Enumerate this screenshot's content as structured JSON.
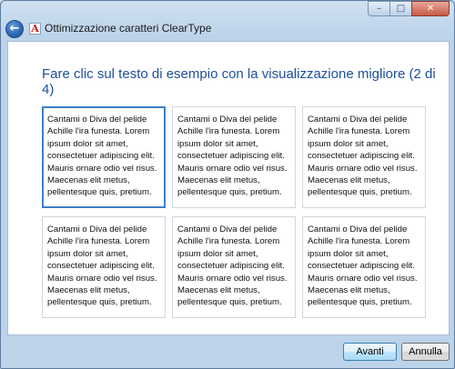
{
  "window": {
    "title": "Ottimizzazione caratteri ClearType",
    "app_icon_glyph": "A",
    "caption_min": "–",
    "caption_max": "□",
    "caption_close": "✕"
  },
  "back_button": {
    "glyph": "←",
    "icon": "back-arrow-icon"
  },
  "heading": "Fare clic sul testo di esempio con la visualizzazione migliore (2 di 4)",
  "samples": [
    {
      "text": "Cantami o Diva del pelide\nAchille l'ira funesta. Lorem\nipsum dolor sit amet,\nconsectetuer adipiscing elit.\nMauris ornare odio vel risus.\nMaecenas elit metus,\npellentesque quis, pretium.",
      "selected": true
    },
    {
      "text": "Cantami o Diva del pelide\nAchille l'ira funesta. Lorem\nipsum dolor sit amet,\nconsectetuer adipiscing elit.\nMauris ornare odio vel risus.\nMaecenas elit metus,\npellentesque quis, pretium.",
      "selected": false
    },
    {
      "text": "Cantami o Diva del pelide\nAchille l'ira funesta. Lorem\nipsum dolor sit amet,\nconsectetuer adipiscing elit.\nMauris ornare odio vel risus.\nMaecenas elit metus,\npellentesque quis, pretium.",
      "selected": false
    },
    {
      "text": "Cantami o Diva del pelide\nAchille l'ira funesta. Lorem\nipsum dolor sit amet,\nconsectetuer adipiscing elit.\nMauris ornare odio vel risus.\nMaecenas elit metus,\npellentesque quis, pretium.",
      "selected": false
    },
    {
      "text": "Cantami o Diva del pelide\nAchille l'ira funesta. Lorem\nipsum dolor sit amet,\nconsectetuer adipiscing elit.\nMauris ornare odio vel risus.\nMaecenas elit metus,\npellentesque quis, pretium.",
      "selected": false
    },
    {
      "text": "Cantami o Diva del pelide\nAchille l'ira funesta. Lorem\nipsum dolor sit amet,\nconsectetuer adipiscing elit.\nMauris ornare odio vel risus.\nMaecenas elit metus,\npellentesque quis, pretium.",
      "selected": false
    }
  ],
  "buttons": {
    "next": "Avanti",
    "cancel": "Annulla"
  },
  "colors": {
    "heading": "#1e4f9c",
    "selection_border": "#3a80c8"
  }
}
